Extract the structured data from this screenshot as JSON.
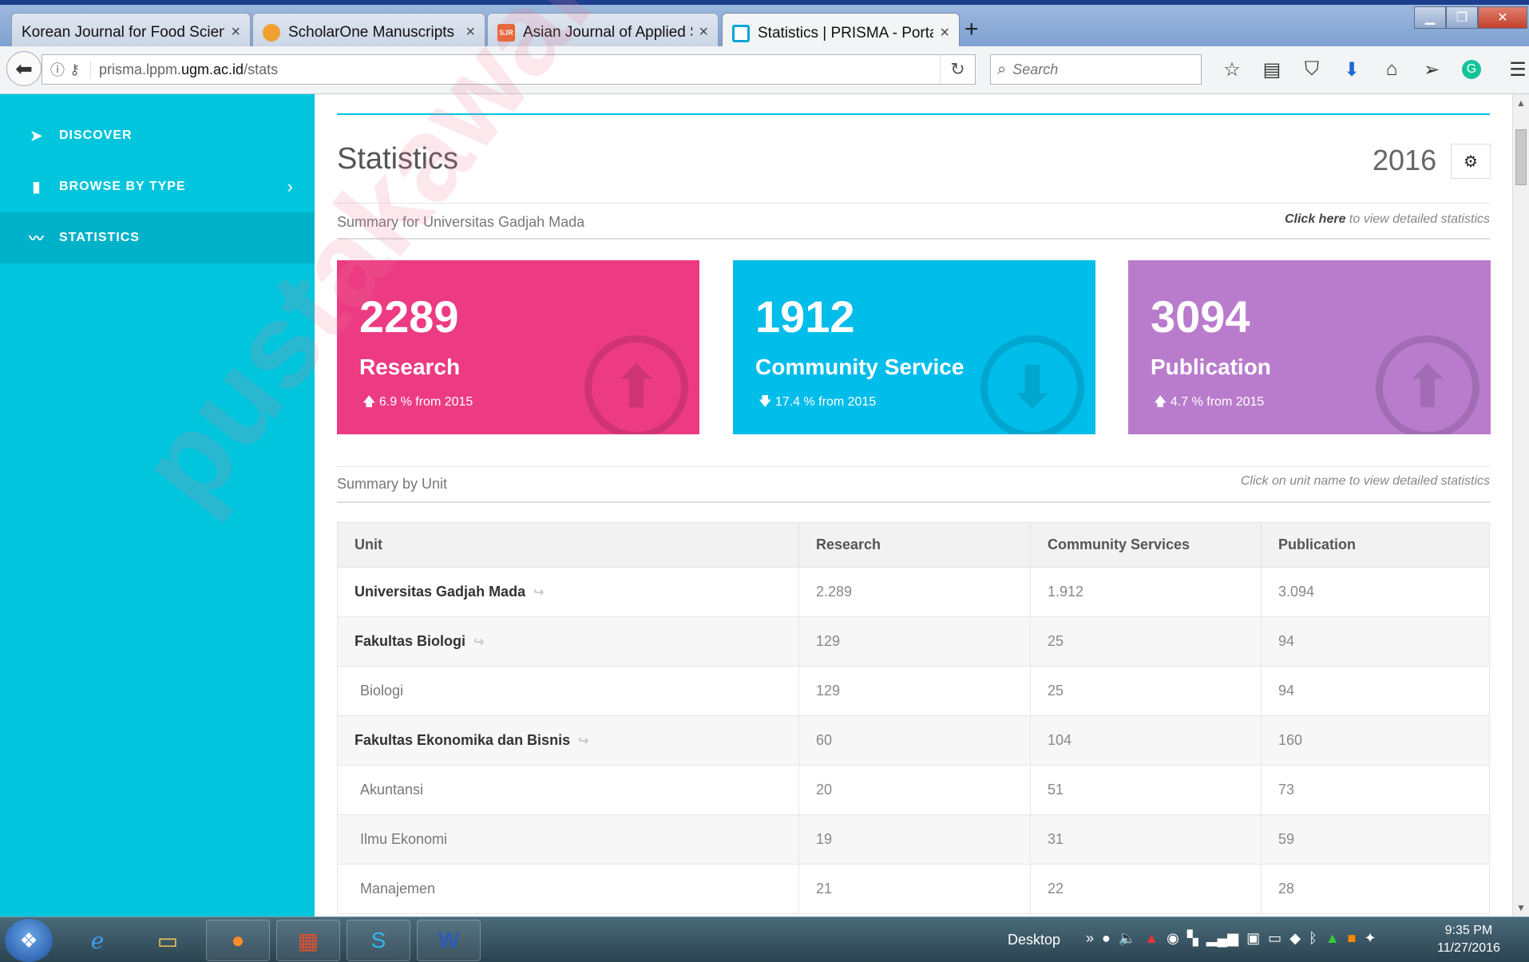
{
  "browser": {
    "tabs": [
      {
        "title": "Korean Journal for Food Scienc...",
        "favicon_color": "#dfe6f0"
      },
      {
        "title": "ScholarOne Manuscripts",
        "favicon_color": "#f0a030"
      },
      {
        "title": "Asian Journal of Applied Sc...",
        "favicon_color": "#e8642c",
        "favicon_text": "SJR"
      },
      {
        "title": "Statistics | PRISMA - Portal ...",
        "favicon_color": "#00a6d6"
      }
    ],
    "close_glyph": "×",
    "new_tab_glyph": "+",
    "url_prefix": "prisma.lppm.",
    "url_domain": "ugm.ac.id",
    "url_path": "/stats",
    "search_placeholder": "Search"
  },
  "sidebar": {
    "items": [
      {
        "label": "DISCOVER",
        "icon": "paper-plane-icon"
      },
      {
        "label": "BROWSE BY TYPE",
        "icon": "book-icon"
      },
      {
        "label": "STATISTICS",
        "icon": "chart-line-icon"
      }
    ]
  },
  "page": {
    "title": "Statistics",
    "year": "2016",
    "summary_label": "Summary for Universitas Gadjah Mada",
    "summary_hint_bold": "Click here",
    "summary_hint_rest": " to view detailed statistics",
    "unit_label": "Summary by Unit",
    "unit_hint": "Click on unit name to view detailed statistics"
  },
  "cards": [
    {
      "value": "2289",
      "label": "Research",
      "change": "6.9 % from 2015",
      "direction": "up",
      "color": "#ec3b83"
    },
    {
      "value": "1912",
      "label": "Community Service",
      "change": "17.4 % from 2015",
      "direction": "down",
      "color": "#00bdea"
    },
    {
      "value": "3094",
      "label": "Publication",
      "change": "4.7 % from 2015",
      "direction": "up",
      "color": "#b97ccd"
    }
  ],
  "table": {
    "headers": [
      "Unit",
      "Research",
      "Community Services",
      "Publication"
    ],
    "rows": [
      {
        "unit": "Universitas Gadjah Mada",
        "research": "2.289",
        "community": "1.912",
        "publication": "3.094",
        "level": "fac"
      },
      {
        "unit": "Fakultas Biologi",
        "research": "129",
        "community": "25",
        "publication": "94",
        "level": "fac"
      },
      {
        "unit": "Biologi",
        "research": "129",
        "community": "25",
        "publication": "94",
        "level": "sub"
      },
      {
        "unit": "Fakultas Ekonomika dan Bisnis",
        "research": "60",
        "community": "104",
        "publication": "160",
        "level": "fac"
      },
      {
        "unit": "Akuntansi",
        "research": "20",
        "community": "51",
        "publication": "73",
        "level": "sub"
      },
      {
        "unit": "Ilmu Ekonomi",
        "research": "19",
        "community": "31",
        "publication": "59",
        "level": "sub"
      },
      {
        "unit": "Manajemen",
        "research": "21",
        "community": "22",
        "publication": "28",
        "level": "sub"
      }
    ]
  },
  "watermark": "pustakawan.lib.ugm.ac",
  "taskbar": {
    "desktop_label": "Desktop",
    "time": "9:35 PM",
    "date": "11/27/2016"
  }
}
